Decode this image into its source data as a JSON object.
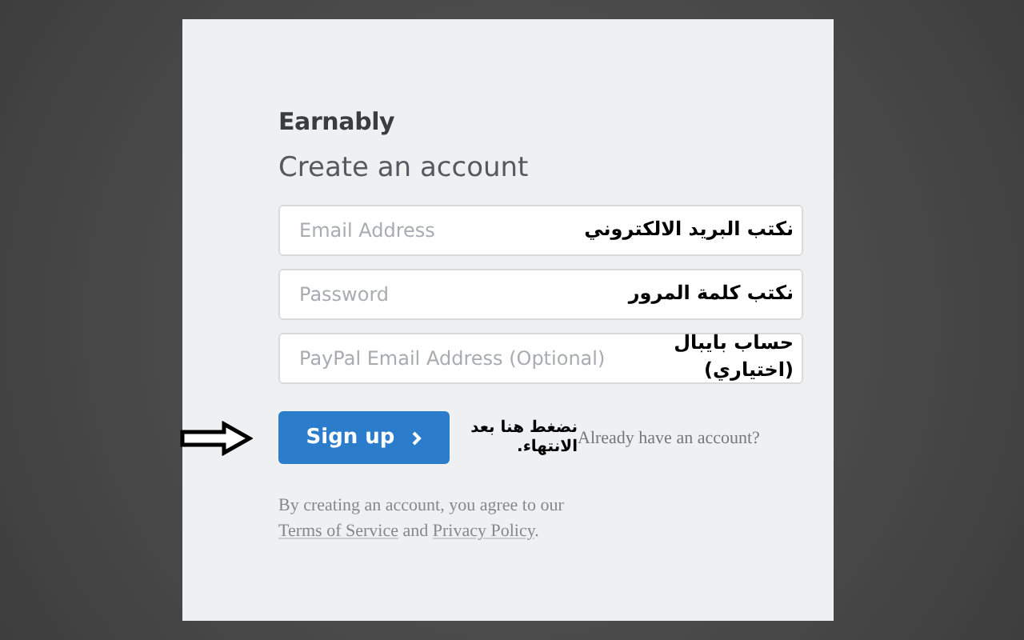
{
  "brand": "Earnably",
  "heading": "Create an account",
  "fields": [
    {
      "placeholder": "Email Address",
      "note": "نكتب البريد الالكتروني"
    },
    {
      "placeholder": "Password",
      "note": "نكتب كلمة المرور"
    },
    {
      "placeholder": "PayPal Email Address (Optional)",
      "note": "حساب بايبال (اختياري)"
    }
  ],
  "signup_button": "Sign up",
  "button_note": "نضغط هنا بعد الانتهاء.",
  "login_link": "Already have an account?",
  "terms": {
    "prefix": "By creating an account, you agree to our",
    "link_1": "Terms of Service",
    "middle": "and",
    "link_2": "Privacy Policy",
    "suffix": "."
  }
}
